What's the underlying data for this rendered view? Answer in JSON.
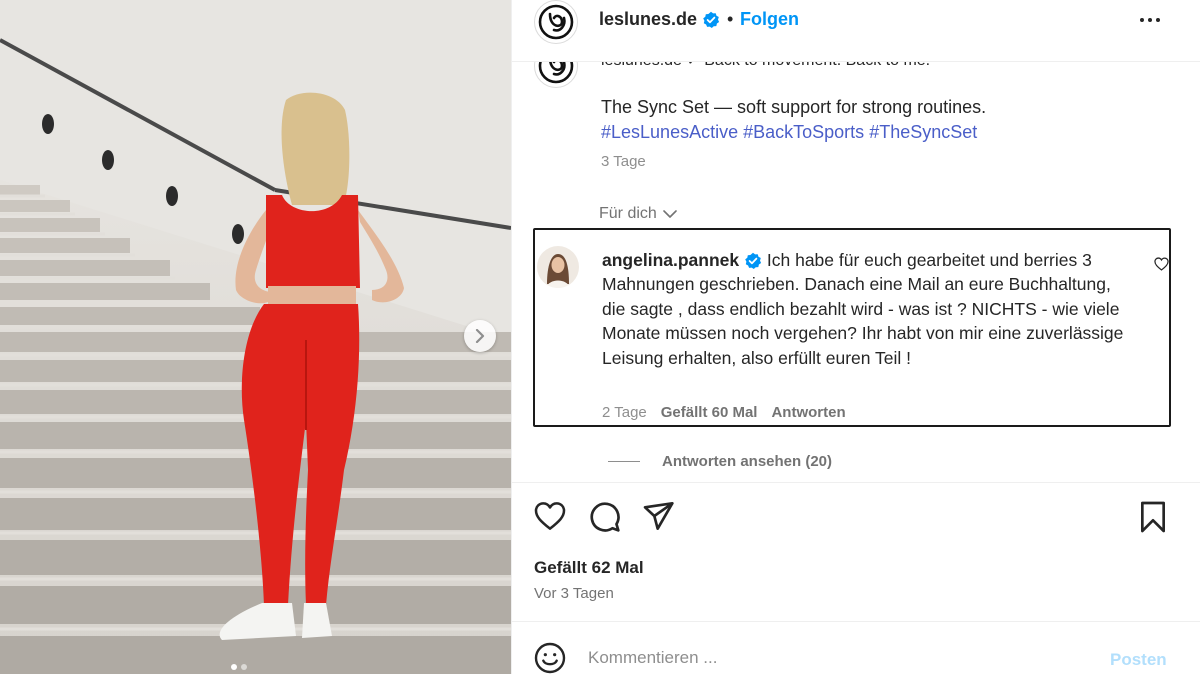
{
  "post": {
    "account": "leslunes.de",
    "follow_label": "Folgen",
    "dot": "•",
    "more_icon": "more-horizontal-icon",
    "caption_cut": "leslunes.de ✓ Back to movement. Back to me.",
    "caption_line": "The Sync Set — soft support for strong routines.",
    "hashtags": [
      "#LesLunesActive",
      "#BackToSports",
      "#TheSyncSet"
    ],
    "caption_time": "3 Tage"
  },
  "filter": {
    "label": "Für dich"
  },
  "comment": {
    "user": "angelina.pannek",
    "text": "Ich habe für euch gearbeitet und berries 3 Mahnungen geschrieben. Danach eine Mail an eure Buchhaltung, die sagte , dass endlich bezahlt wird - was ist ? NICHTS - wie viele Monate müssen noch vergehen? Ihr habt von mir eine zuverlässige Leisung erhalten, also erfüllt euren Teil !",
    "time": "2 Tage",
    "likes": "Gefällt 60 Mal",
    "reply_label": "Antworten"
  },
  "view_replies": "Antworten ansehen (20)",
  "likes_count": "Gefällt 62 Mal",
  "posted_ago": "Vor 3 Tagen",
  "composer": {
    "placeholder": "Kommentieren ...",
    "post_label": "Posten"
  },
  "carousel": {
    "slide": 1,
    "total": 2
  },
  "colors": {
    "accent": "#0095f6",
    "hashtag": "#4a5ec8",
    "outfit": "#e0231c",
    "post_disabled": "#b2dffc"
  }
}
